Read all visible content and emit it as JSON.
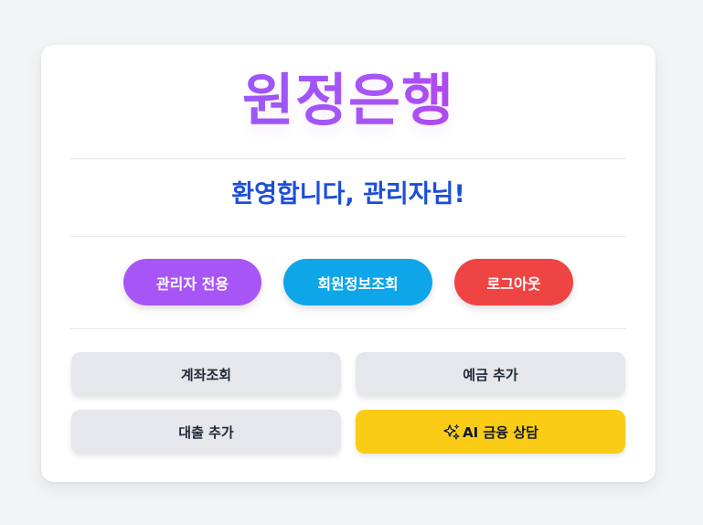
{
  "app": {
    "title": "원정은행"
  },
  "welcome": "환영합니다, 관리자님!",
  "nav": {
    "admin_label": "관리자 전용",
    "member_info_label": "회원정보조회",
    "logout_label": "로그아웃"
  },
  "actions": {
    "account_inquiry": "계좌조회",
    "add_deposit": "예금 추가",
    "add_loan": "대출 추가",
    "ai_consult": "AI 금융 상담"
  },
  "icons": {
    "ai_consult": "sparkles-icon"
  },
  "colors": {
    "title_gradient_start": "#8b5cf6",
    "title_gradient_end": "#c026d3",
    "welcome_text": "#1d4ed8",
    "admin_button": "#a855f7",
    "member_info_button": "#0ea5e9",
    "logout_button": "#ef4444",
    "ai_button": "#facc15",
    "tile_background": "#e5e7eb"
  }
}
